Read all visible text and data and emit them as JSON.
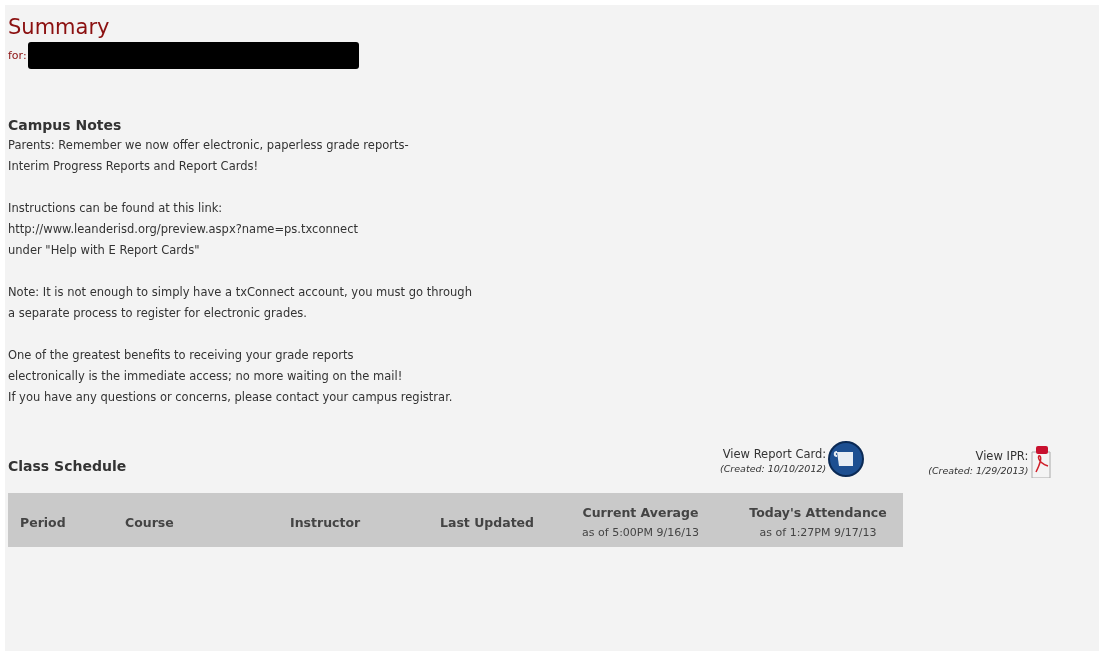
{
  "header": {
    "title": "Summary",
    "for_label": "for:"
  },
  "campus_notes": {
    "title": "Campus Notes",
    "paragraphs": [
      [
        "Parents: Remember we now offer electronic, paperless grade reports-",
        "Interim Progress Reports and Report Cards!"
      ],
      [
        "Instructions can be found at this link:",
        "http://www.leanderisd.org/preview.aspx?name=ps.txconnect",
        "under \"Help with E Report Cards\""
      ],
      [
        "Note: It is not enough to simply have a txConnect account, you must go through",
        "a separate process to register for electronic grades."
      ],
      [
        "One of the greatest benefits to receiving your grade reports",
        "electronically is the immediate access; no more waiting on the mail!",
        "If you have any questions or concerns, please contact your campus registrar."
      ]
    ]
  },
  "class_schedule": {
    "title": "Class Schedule",
    "reports": [
      {
        "kind": "report_card",
        "label": "View Report Card:",
        "created": "(Created: 10/10/2012)"
      },
      {
        "kind": "pdf",
        "label": "View IPR:",
        "created": "(Created: 1/29/2013)"
      }
    ],
    "columns": [
      {
        "label": "Period"
      },
      {
        "label": "Course"
      },
      {
        "label": "Instructor"
      },
      {
        "label": "Last Updated"
      },
      {
        "label": "Current Average",
        "sub": "as of 5:00PM 9/16/13"
      },
      {
        "label": "Today's Attendance",
        "sub": "as of 1:27PM 9/17/13"
      }
    ]
  }
}
